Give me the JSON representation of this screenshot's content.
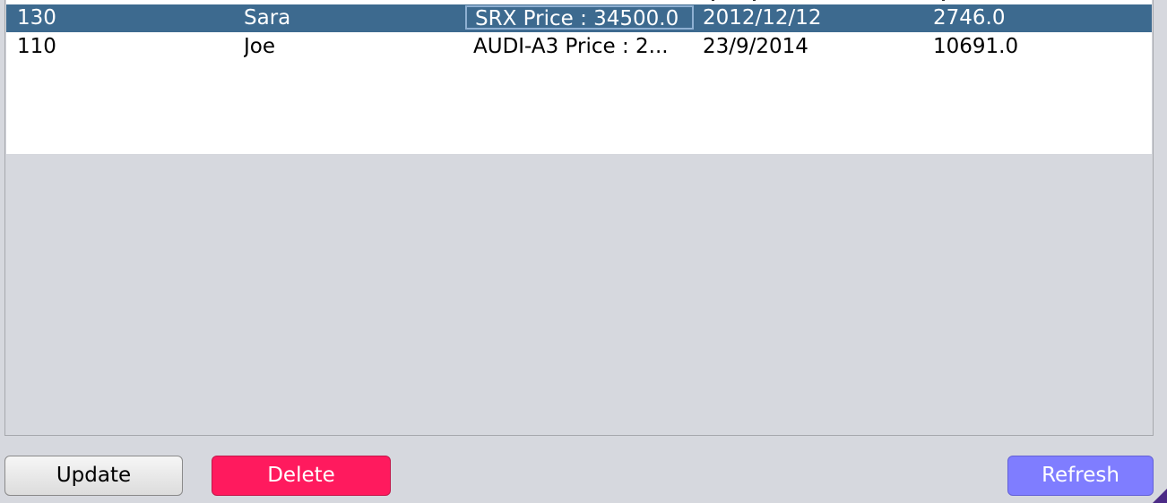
{
  "table": {
    "rows": [
      {
        "id": "130",
        "name": "Sara",
        "car": "SRX Price : 34500.0",
        "date": "2012/12/12",
        "total": "2746.0",
        "selected": true
      },
      {
        "id": "110",
        "name": "Joe",
        "car": "AUDI-A3 Price : 2...",
        "date": "23/9/2014",
        "total": "10691.0",
        "selected": false
      }
    ],
    "selection_color": "#3d6a8f"
  },
  "buttons": {
    "update_label": "Update",
    "delete_label": "Delete",
    "refresh_label": "Refresh",
    "delete_color": "#ff1a5e",
    "refresh_color": "#7f7dff"
  }
}
